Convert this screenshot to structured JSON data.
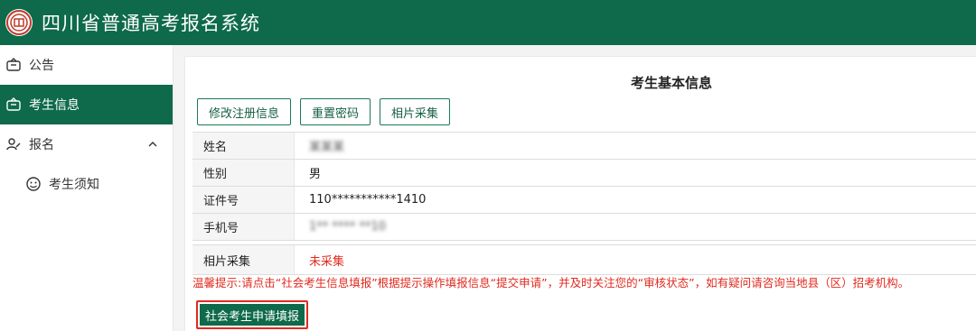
{
  "header": {
    "title": "四川省普通高考报名系统",
    "logo_icon": "school-seal-icon",
    "brand_color": "#0e6a4a"
  },
  "sidebar": {
    "items": [
      {
        "label": "公告",
        "icon": "notice-icon"
      },
      {
        "label": "考生信息",
        "icon": "profile-card-icon",
        "active": true
      },
      {
        "label": "报名",
        "icon": "edit-user-icon",
        "expanded": true
      }
    ],
    "subitems": [
      {
        "label": "考生须知",
        "icon": "smile-icon"
      }
    ]
  },
  "main": {
    "title": "考生基本信息",
    "actions": [
      {
        "label": "修改注册信息"
      },
      {
        "label": "重置密码"
      },
      {
        "label": "相片采集"
      }
    ],
    "fields": [
      {
        "label": "姓名",
        "value": "某某某"
      },
      {
        "label": "性别",
        "value": "男"
      },
      {
        "label": "证件号",
        "value": "110***********1410"
      },
      {
        "label": "手机号",
        "value": "1** **** **10"
      }
    ],
    "photo_field": {
      "label": "相片采集",
      "value": "未采集"
    },
    "notice": "温馨提示:请点击“社会考生信息填报”根据提示操作填报信息“提交申请”，并及时关注您的“审核状态”，如有疑问请咨询当地县（区）招考机构。",
    "submit_label": "社会考生申请填报",
    "accent_red": "#e12a1f"
  }
}
